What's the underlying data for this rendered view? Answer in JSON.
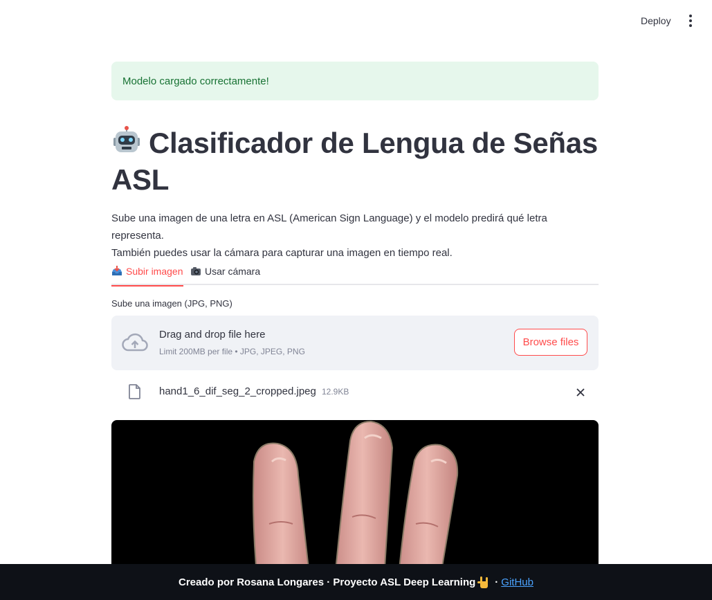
{
  "header": {
    "deploy_label": "Deploy",
    "menu_icon": "kebab-menu-icon"
  },
  "alert": {
    "text": "Modelo cargado correctamente!"
  },
  "page": {
    "title_line1": "Clasificador de Lengua de Señas",
    "title_line2": "ASL",
    "title_icon": "robot-emoji",
    "description_line1": "Sube una imagen de una letra en ASL (American Sign Language) y el modelo predirá qué letra representa.",
    "description_line2": "También puedes usar la cámara para capturar una imagen en tiempo real."
  },
  "tabs": [
    {
      "label": "Subir imagen",
      "icon": "inbox-tray-emoji",
      "active": true
    },
    {
      "label": "Usar cámara",
      "icon": "camera-emoji",
      "active": false
    }
  ],
  "uploader": {
    "label": "Sube una imagen (JPG, PNG)",
    "drop_title": "Drag and drop file here",
    "drop_subtitle": "Limit 200MB per file • JPG, JPEG, PNG",
    "browse_label": "Browse files"
  },
  "file": {
    "name": "hand1_6_dif_seg_2_cropped.jpeg",
    "size": "12.9KB"
  },
  "footer": {
    "text": "Creado por Rosana Longares · Proyecto ASL Deep Learning",
    "separator": "·",
    "link_label": "GitHub",
    "icon": "sign-of-horns-emoji"
  },
  "colors": {
    "accent": "#ff4b4b",
    "success_bg": "#e6f7ec",
    "success_text": "#177233",
    "footer_bg": "#0e1117",
    "link": "#4ba3ff"
  }
}
